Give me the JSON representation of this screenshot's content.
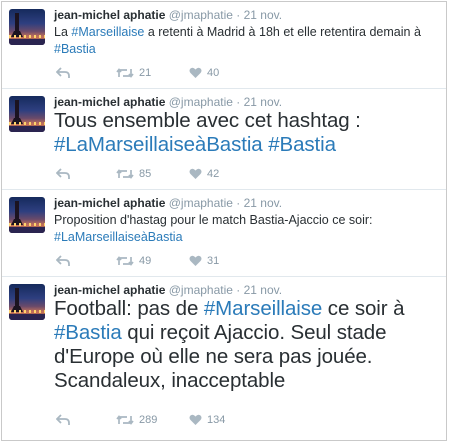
{
  "tweets": [
    {
      "author_name": "jean-michel aphatie",
      "handle": "@jmaphatie",
      "separator": "·",
      "date": "21 nov.",
      "text": [
        {
          "t": "La "
        },
        {
          "t": "#Marseillaise",
          "tag": true
        },
        {
          "t": " a retenti à Madrid à 18h et elle retentira demain à "
        },
        {
          "t": "#Bastia",
          "tag": true
        }
      ],
      "retweets": "21",
      "likes": "40"
    },
    {
      "author_name": "jean-michel aphatie",
      "handle": "@jmaphatie",
      "separator": "·",
      "date": "21 nov.",
      "text": [
        {
          "t": "Tous ensemble avec cet hashtag : "
        },
        {
          "t": "#LaMarseillaiseàBastia",
          "tag": true
        },
        {
          "t": " "
        },
        {
          "t": "#Bastia",
          "tag": true
        }
      ],
      "retweets": "85",
      "likes": "42"
    },
    {
      "author_name": "jean-michel aphatie",
      "handle": "@jmaphatie",
      "separator": "·",
      "date": "21 nov.",
      "text": [
        {
          "t": "Proposition d'hastag pour le match Bastia-Ajaccio ce soir: "
        },
        {
          "t": "#LaMarseillaiseàBastia",
          "tag": true
        }
      ],
      "retweets": "49",
      "likes": "31"
    },
    {
      "author_name": "jean-michel aphatie",
      "handle": "@jmaphatie",
      "separator": "·",
      "date": "21 nov.",
      "text": [
        {
          "t": "Football: pas de "
        },
        {
          "t": "#Marseillaise",
          "tag": true
        },
        {
          "t": " ce soir à "
        },
        {
          "t": "#Bastia",
          "tag": true
        },
        {
          "t": " qui reçoit Ajaccio. Seul stade d'Europe où elle ne sera pas jouée. Scandaleux, inacceptable"
        }
      ],
      "retweets": "289",
      "likes": "134"
    }
  ],
  "icons": {
    "reply": "reply-arrow-icon",
    "retweet": "retweet-icon",
    "like": "heart-icon"
  },
  "colors": {
    "hashtag": "#2b7bb9",
    "meta": "#8899a6",
    "text": "#292f33"
  }
}
